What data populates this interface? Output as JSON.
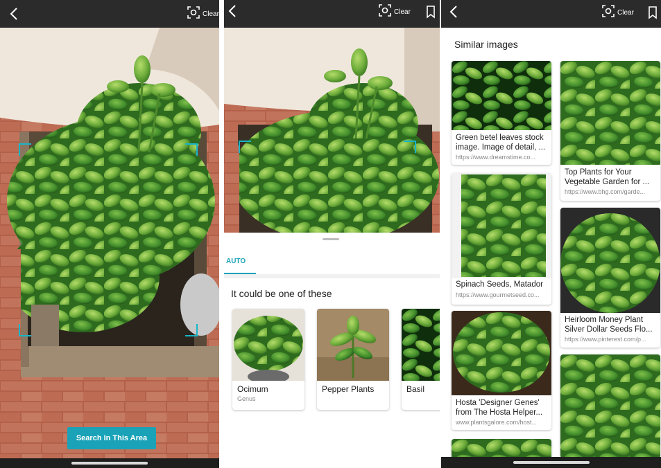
{
  "toolbar": {
    "clear_label": "Clear"
  },
  "panel1": {
    "search_button_label": "Search In This Area"
  },
  "panel2": {
    "tab_auto_label": "AUTO",
    "section_title": "It could be one of these",
    "results": [
      {
        "name": "Ocimum",
        "subtitle": "Genus"
      },
      {
        "name": "Pepper Plants",
        "subtitle": ""
      },
      {
        "name": "Basil",
        "subtitle": ""
      }
    ]
  },
  "panel3": {
    "section_title": "Similar images",
    "cards": [
      {
        "line1": "Green betel leaves stock",
        "line2": "image. Image of detail, ...",
        "url": "https://www.dreamstime.co..."
      },
      {
        "line1": "Top Plants for Your",
        "line2": "Vegetable Garden for ...",
        "url": "https://www.bhg.com/garde..."
      },
      {
        "line1": "Spinach Seeds, Matador",
        "line2": "",
        "url": "https://www.gourmetseed.co..."
      },
      {
        "line1": "Heirloom Money Plant",
        "line2": "Silver Dollar Seeds Flo...",
        "url": "https://www.pinterest.com/p..."
      },
      {
        "line1": "Hosta 'Designer Genes'",
        "line2": "from The Hosta Helper...",
        "url": "www.plantsgalore.com/host..."
      }
    ]
  },
  "colors": {
    "accent": "#1aa3b8",
    "toolbar": "#2b2b2b",
    "leaf_green": "#6fae3c"
  }
}
